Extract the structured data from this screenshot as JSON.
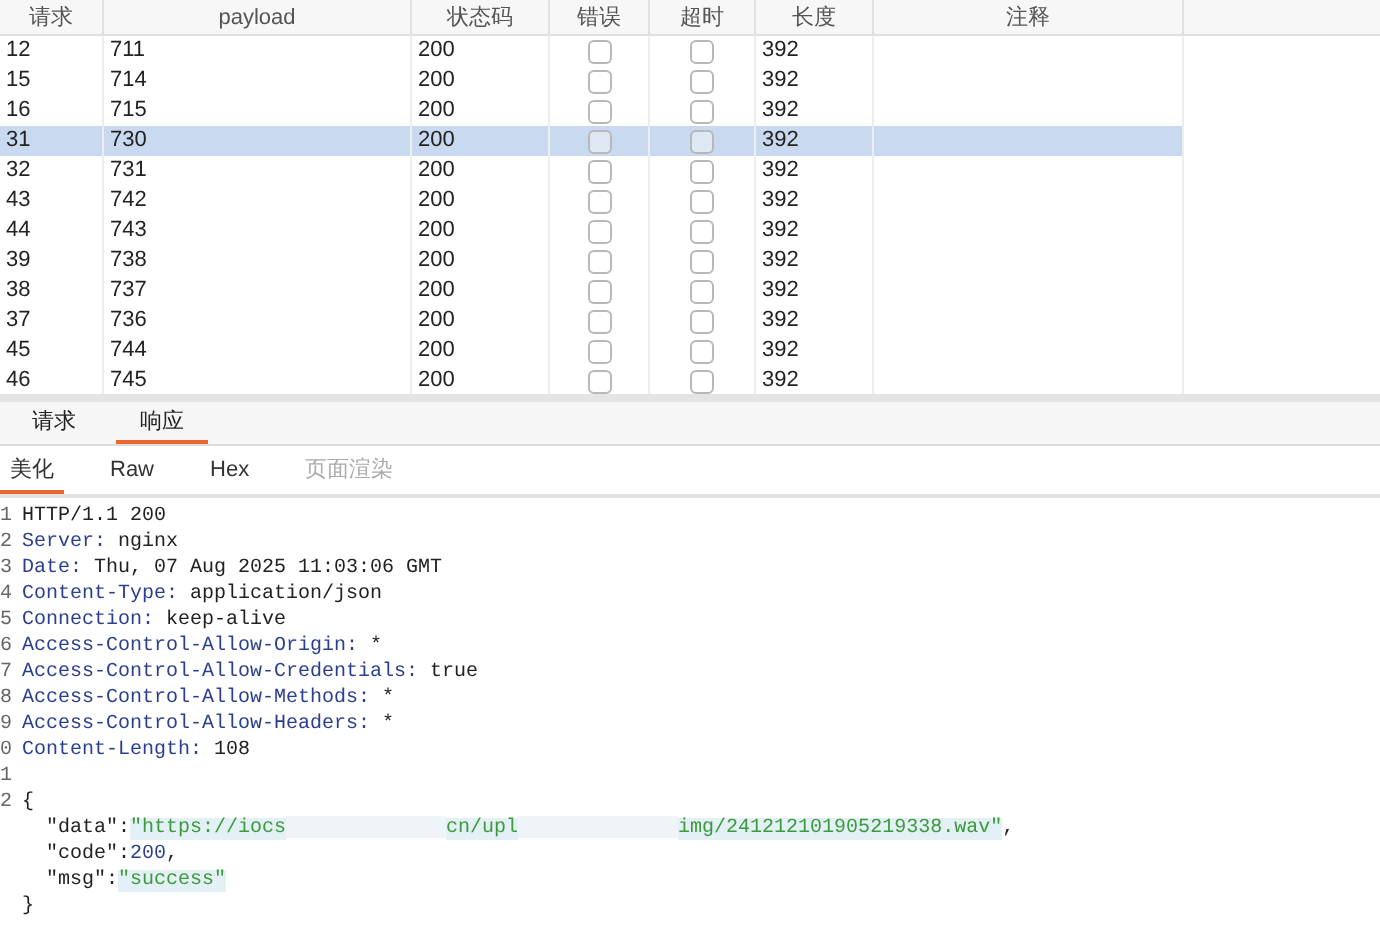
{
  "table": {
    "columns": [
      "请求",
      "payload",
      "状态码",
      "错误",
      "超时",
      "长度",
      "注释"
    ],
    "rows": [
      {
        "request": "12",
        "payload": "711",
        "status": "200",
        "error": false,
        "timeout": false,
        "length": "392",
        "selected": false
      },
      {
        "request": "15",
        "payload": "714",
        "status": "200",
        "error": false,
        "timeout": false,
        "length": "392",
        "selected": false
      },
      {
        "request": "16",
        "payload": "715",
        "status": "200",
        "error": false,
        "timeout": false,
        "length": "392",
        "selected": false
      },
      {
        "request": "31",
        "payload": "730",
        "status": "200",
        "error": false,
        "timeout": false,
        "length": "392",
        "selected": true
      },
      {
        "request": "32",
        "payload": "731",
        "status": "200",
        "error": false,
        "timeout": false,
        "length": "392",
        "selected": false
      },
      {
        "request": "43",
        "payload": "742",
        "status": "200",
        "error": false,
        "timeout": false,
        "length": "392",
        "selected": false
      },
      {
        "request": "44",
        "payload": "743",
        "status": "200",
        "error": false,
        "timeout": false,
        "length": "392",
        "selected": false
      },
      {
        "request": "39",
        "payload": "738",
        "status": "200",
        "error": false,
        "timeout": false,
        "length": "392",
        "selected": false
      },
      {
        "request": "38",
        "payload": "737",
        "status": "200",
        "error": false,
        "timeout": false,
        "length": "392",
        "selected": false
      },
      {
        "request": "37",
        "payload": "736",
        "status": "200",
        "error": false,
        "timeout": false,
        "length": "392",
        "selected": false
      },
      {
        "request": "45",
        "payload": "744",
        "status": "200",
        "error": false,
        "timeout": false,
        "length": "392",
        "selected": false
      },
      {
        "request": "46",
        "payload": "745",
        "status": "200",
        "error": false,
        "timeout": false,
        "length": "392",
        "selected": false
      }
    ]
  },
  "tabs": [
    {
      "label": "请求",
      "selected": false
    },
    {
      "label": "响应",
      "selected": true
    }
  ],
  "view_tabs": [
    {
      "label": "美化",
      "selected": true,
      "disabled": false
    },
    {
      "label": "Raw",
      "selected": false,
      "disabled": false
    },
    {
      "label": "Hex",
      "selected": false,
      "disabled": false
    },
    {
      "label": "页面渲染",
      "selected": false,
      "disabled": true
    }
  ],
  "code_lines": [
    {
      "number": "1",
      "parts": [
        {
          "kind": "plain",
          "text": "HTTP/1.1 200"
        }
      ]
    },
    {
      "number": "2",
      "parts": [
        {
          "kind": "key",
          "text": "Server:"
        },
        {
          "kind": "plain",
          "text": " nginx"
        }
      ]
    },
    {
      "number": "3",
      "parts": [
        {
          "kind": "key",
          "text": "Date:"
        },
        {
          "kind": "plain",
          "text": " Thu, 07 Aug 2025 11:03:06 GMT"
        }
      ]
    },
    {
      "number": "4",
      "parts": [
        {
          "kind": "key",
          "text": "Content-Type:"
        },
        {
          "kind": "plain",
          "text": " application/json"
        }
      ]
    },
    {
      "number": "5",
      "parts": [
        {
          "kind": "key",
          "text": "Connection:"
        },
        {
          "kind": "plain",
          "text": " keep-alive"
        }
      ]
    },
    {
      "number": "6",
      "parts": [
        {
          "kind": "key",
          "text": "Access-Control-Allow-Origin:"
        },
        {
          "kind": "plain",
          "text": " *"
        }
      ]
    },
    {
      "number": "7",
      "parts": [
        {
          "kind": "key",
          "text": "Access-Control-Allow-Credentials:"
        },
        {
          "kind": "plain",
          "text": " true"
        }
      ]
    },
    {
      "number": "8",
      "parts": [
        {
          "kind": "key",
          "text": "Access-Control-Allow-Methods:"
        },
        {
          "kind": "plain",
          "text": " *"
        }
      ]
    },
    {
      "number": "9",
      "parts": [
        {
          "kind": "key",
          "text": "Access-Control-Allow-Headers:"
        },
        {
          "kind": "plain",
          "text": " *"
        }
      ]
    },
    {
      "number": "0",
      "parts": [
        {
          "kind": "key",
          "text": "Content-Length:"
        },
        {
          "kind": "plain",
          "text": " 108"
        }
      ]
    },
    {
      "number": "1"
    },
    {
      "number": "2",
      "parts": [
        {
          "kind": "plain",
          "text": "{"
        }
      ]
    },
    {
      "parts": [
        {
          "kind": "plain",
          "text": "  \"data\":"
        },
        {
          "kind": "string",
          "text": "\"https://iocs"
        },
        {
          "kind": "redacted"
        },
        {
          "kind": "string",
          "text": "cn/upl"
        },
        {
          "kind": "redacted"
        },
        {
          "kind": "string",
          "text": "img/241212101905219338.wav\""
        },
        {
          "kind": "plain",
          "text": ","
        }
      ]
    },
    {
      "parts": [
        {
          "kind": "plain",
          "text": "  \"code\":"
        },
        {
          "kind": "number",
          "text": "200"
        },
        {
          "kind": "plain",
          "text": ","
        }
      ]
    },
    {
      "parts": [
        {
          "kind": "plain",
          "text": "  \"msg\":"
        },
        {
          "kind": "string",
          "text": "\"success\""
        }
      ]
    },
    {
      "parts": [
        {
          "kind": "plain",
          "text": "}"
        }
      ]
    }
  ]
}
